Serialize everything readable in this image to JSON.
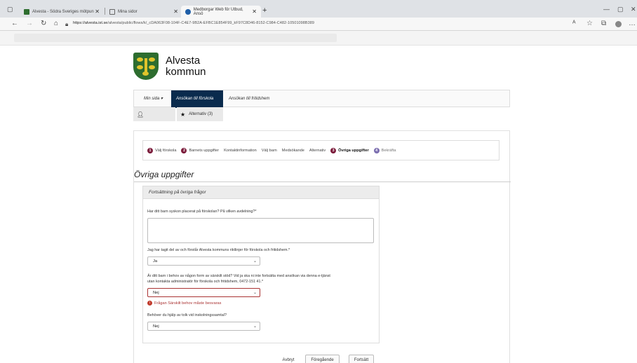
{
  "browser": {
    "tabs": [
      {
        "title": "Alvesta - Södra Sveriges mötpun",
        "active": false
      },
      {
        "title": "Mina sidor",
        "active": false
      },
      {
        "title": "Medborgar Web för Utbud, Ansö",
        "active": true
      }
    ],
    "url_host": "https://alvesta.ist.se",
    "url_path": "/alvesta/public/flows/k/_cDA063F08-104F-C4E7-9B2A-EFBC1E854F99_kF97C8D46-8152-C984-C482-10501098B389"
  },
  "org": {
    "line1": "Alvesta",
    "line2": "kommun"
  },
  "nav": {
    "items": [
      {
        "label": "Min sida ▾"
      },
      {
        "label": "Ansökan till förskola"
      },
      {
        "label": "Ansökan till fritidshem"
      }
    ]
  },
  "subnav": {
    "alternatives": "Alternativ (3)"
  },
  "steps": [
    {
      "num": "1",
      "label": "Välj förskola"
    },
    {
      "num": "2",
      "label": "Barnets uppgifter"
    },
    {
      "num": "",
      "label": "Kontaktinformation"
    },
    {
      "num": "",
      "label": "Välj barn"
    },
    {
      "num": "",
      "label": "Medsökande"
    },
    {
      "num": "",
      "label": "Alternativ"
    },
    {
      "num": "3",
      "label": "Övriga uppgifter"
    },
    {
      "num": "4",
      "label": "Bekräfta"
    }
  ],
  "section": {
    "title": "Övriga uppgifter",
    "fieldset_title": "Fortsättning på övriga frågor"
  },
  "questions": {
    "q1": "Har ditt barn syskon placerat på förskolan? På vilken avdelning?*",
    "q2": "Jag har tagit del av och förstår Alvesta kommuns riktlinjer för förskola och fritidshem.*",
    "q2_value": "Ja",
    "q3_line1": "Är ditt barn i behov av någon form av särskilt stöd? Vid ja ska ni inte fortsätta med ansökan via denna e-tjänst",
    "q3_line2": "utan kontakta administratör för förskola och fritidshem, 0472-151 41.*",
    "q3_value": "Nej",
    "q3_error": "Frågan Särskilt behov måste besvaras",
    "q4": "Behöver du hjälp av tolk vid inskolningssamtal?",
    "q4_value": "Nej"
  },
  "buttons": {
    "cancel": "Avbryt",
    "previous": "Föregående",
    "next": "Fortsätt"
  }
}
